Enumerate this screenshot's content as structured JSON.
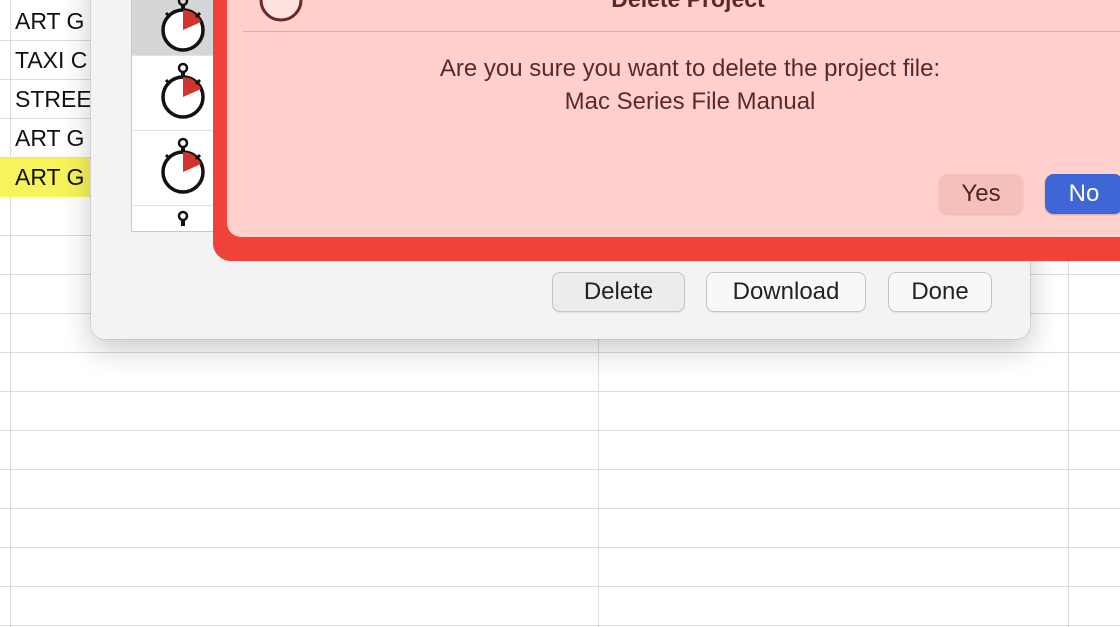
{
  "spreadsheet": {
    "cells": [
      "ART G",
      "TAXI C",
      "STREE",
      "ART G",
      "ART G"
    ],
    "highlight_color": "#f7f35a"
  },
  "project_list": {
    "icon": "stopwatch-icon",
    "selected_index": 0
  },
  "dialog_buttons": {
    "delete": "Delete",
    "download": "Download",
    "done": "Done"
  },
  "alert": {
    "title": "Delete Project",
    "message_line1": "Are you sure you want to delete the project file:",
    "message_line2": "Mac Series File Manual",
    "yes_label": "Yes",
    "no_label": "No",
    "accent_color": "#3e66d4",
    "background_color": "#ffd0cc",
    "outline_color": "#f0413a"
  }
}
